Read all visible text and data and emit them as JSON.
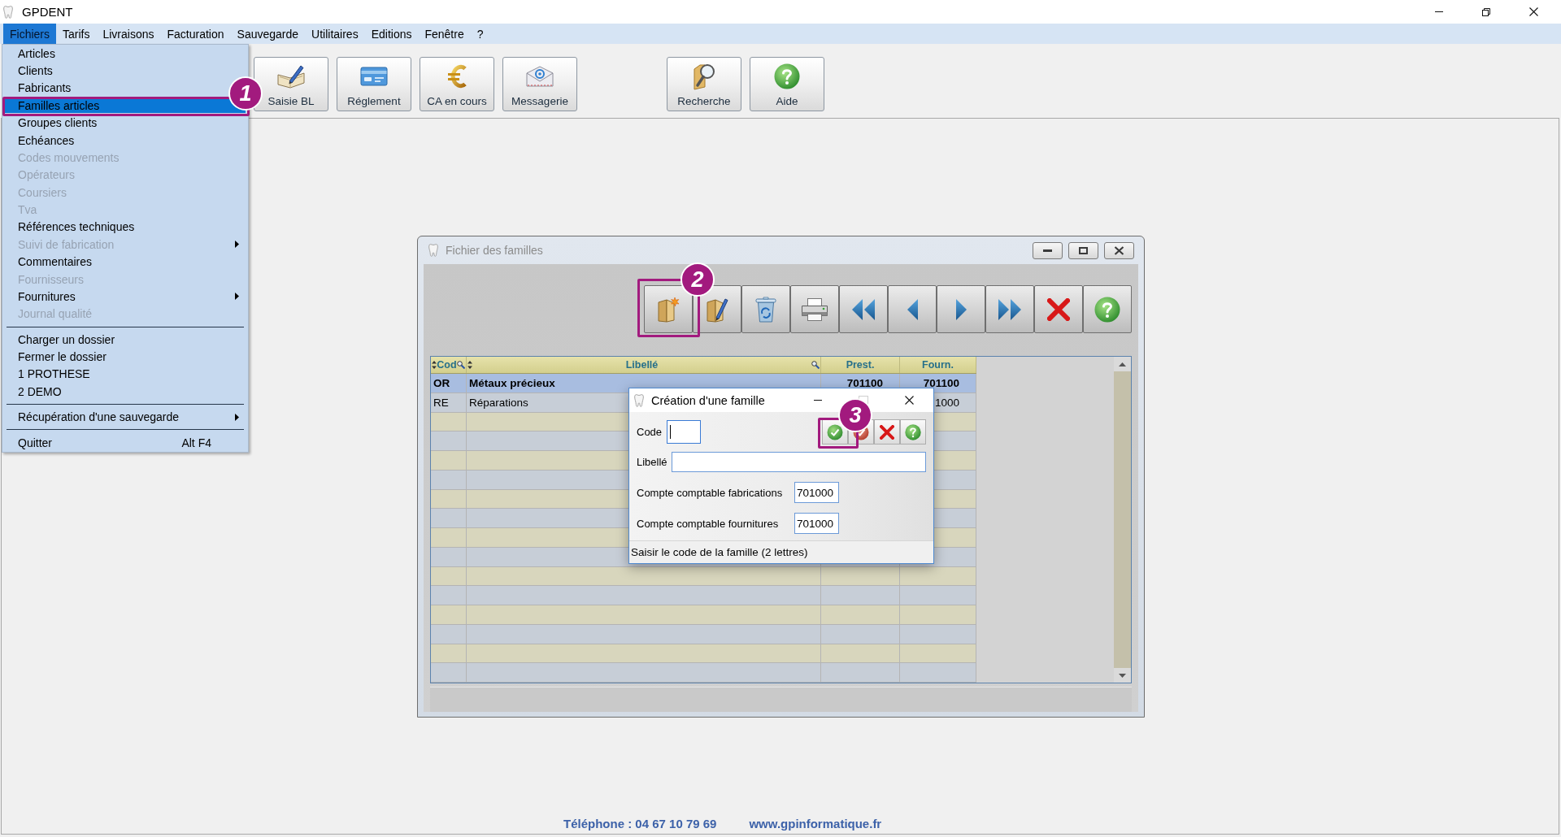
{
  "window": {
    "title": "GPDENT"
  },
  "menu_bar": [
    {
      "label": "Fichiers",
      "selected": true
    },
    {
      "label": "Tarifs",
      "selected": false
    },
    {
      "label": "Livraisons",
      "selected": false
    },
    {
      "label": "Facturation",
      "selected": false
    },
    {
      "label": "Sauvegarde",
      "selected": false
    },
    {
      "label": "Utilitaires",
      "selected": false
    },
    {
      "label": "Editions",
      "selected": false
    },
    {
      "label": "Fenêtre",
      "selected": false
    },
    {
      "label": "?",
      "selected": false
    }
  ],
  "file_menu": [
    {
      "kind": "item",
      "label": "Articles",
      "selected": false,
      "disabled": false,
      "submenu": false
    },
    {
      "kind": "item",
      "label": "Clients",
      "selected": false,
      "disabled": false,
      "submenu": false
    },
    {
      "kind": "item",
      "label": "Fabricants",
      "selected": false,
      "disabled": false,
      "submenu": false
    },
    {
      "kind": "item",
      "label": "Familles articles",
      "selected": true,
      "disabled": false,
      "submenu": false
    },
    {
      "kind": "item",
      "label": "Groupes clients",
      "selected": false,
      "disabled": false,
      "submenu": false
    },
    {
      "kind": "item",
      "label": "Echéances",
      "selected": false,
      "disabled": false,
      "submenu": false
    },
    {
      "kind": "item",
      "label": "Codes mouvements",
      "selected": false,
      "disabled": true,
      "submenu": false
    },
    {
      "kind": "item",
      "label": "Opérateurs",
      "selected": false,
      "disabled": true,
      "submenu": false
    },
    {
      "kind": "item",
      "label": "Coursiers",
      "selected": false,
      "disabled": true,
      "submenu": false
    },
    {
      "kind": "item",
      "label": "Tva",
      "selected": false,
      "disabled": true,
      "submenu": false
    },
    {
      "kind": "item",
      "label": "Références techniques",
      "selected": false,
      "disabled": false,
      "submenu": false
    },
    {
      "kind": "item",
      "label": "Suivi de fabrication",
      "selected": false,
      "disabled": true,
      "submenu": true
    },
    {
      "kind": "item",
      "label": "Commentaires",
      "selected": false,
      "disabled": false,
      "submenu": false
    },
    {
      "kind": "item",
      "label": "Fournisseurs",
      "selected": false,
      "disabled": true,
      "submenu": false
    },
    {
      "kind": "item",
      "label": "Fournitures",
      "selected": false,
      "disabled": false,
      "submenu": true
    },
    {
      "kind": "item",
      "label": "Journal qualité",
      "selected": false,
      "disabled": true,
      "submenu": false
    },
    {
      "kind": "separator"
    },
    {
      "kind": "item",
      "label": "Charger un dossier",
      "selected": false,
      "disabled": false,
      "submenu": false
    },
    {
      "kind": "item",
      "label": "Fermer le dossier",
      "selected": false,
      "disabled": false,
      "submenu": false
    },
    {
      "kind": "item",
      "label": "1 PROTHESE",
      "selected": false,
      "disabled": false,
      "submenu": false
    },
    {
      "kind": "item",
      "label": "2 DEMO",
      "selected": false,
      "disabled": false,
      "submenu": false
    },
    {
      "kind": "separator"
    },
    {
      "kind": "item",
      "label": "Récupération d'une sauvegarde",
      "selected": false,
      "disabled": false,
      "submenu": true
    },
    {
      "kind": "separator"
    },
    {
      "kind": "item",
      "label": "Quitter",
      "shortcut": "Alt F4",
      "selected": false,
      "disabled": false,
      "submenu": false
    }
  ],
  "toolbar": {
    "groups": [
      {
        "buttons": [
          {
            "label": "Saisie BL"
          },
          {
            "label": "Réglement"
          },
          {
            "label": "CA en cours"
          },
          {
            "label": "Messagerie"
          }
        ]
      },
      {
        "buttons": [
          {
            "label": "Recherche"
          },
          {
            "label": "Aide"
          }
        ]
      }
    ]
  },
  "families_window": {
    "title": "Fichier des familles",
    "active": false,
    "table": {
      "columns": [
        "Cod",
        "Libellé",
        "Prest.",
        "Fourn."
      ],
      "rows": [
        {
          "code": "OR",
          "label": "Métaux précieux",
          "prest": "701100",
          "fourn": "701100",
          "selected": true
        },
        {
          "code": "RE",
          "label": "Réparations",
          "fourn": "1000",
          "selected": false
        }
      ]
    }
  },
  "dialog": {
    "title": "Création d'une famille",
    "fields": [
      {
        "kind": "code",
        "label": "Code",
        "focused": true
      },
      {
        "kind": "text",
        "label": "Libellé",
        "focused": false
      },
      {
        "kind": "account",
        "label": "Compte comptable fabrications",
        "value": "701000",
        "focused": false
      },
      {
        "kind": "account",
        "label": "Compte comptable fournitures",
        "value": "701000",
        "focused": false
      }
    ],
    "status": "Saisir le code de la famille (2 lettres)"
  },
  "annotations": [
    {
      "label": "1"
    },
    {
      "label": "2"
    },
    {
      "label": "3"
    }
  ],
  "footer": {
    "phone": "Téléphone : 04 67 10 79 69",
    "website": "www.gpinformatique.fr"
  }
}
